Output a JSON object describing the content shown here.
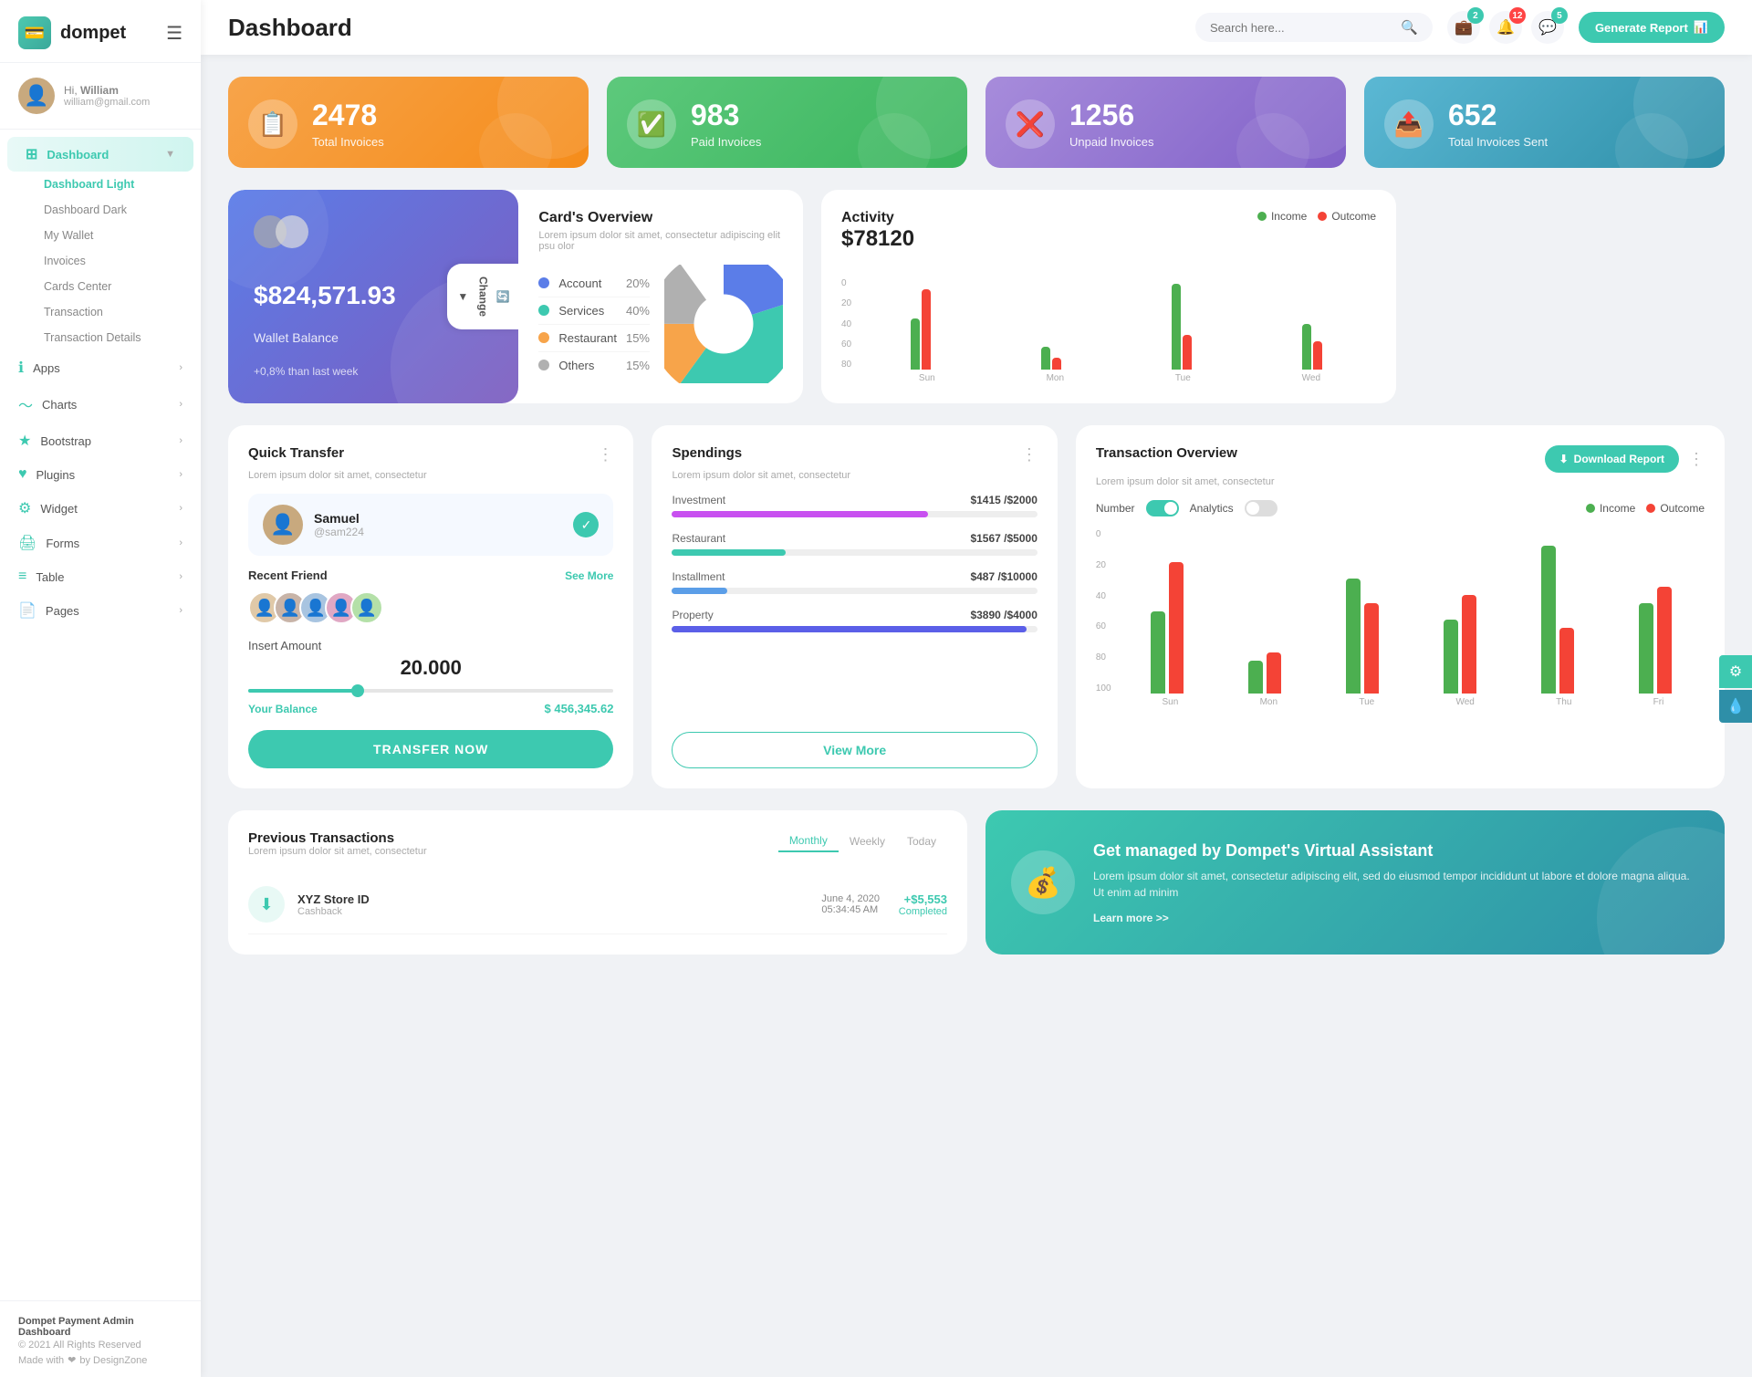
{
  "app": {
    "name": "dompet",
    "hamburger": "☰"
  },
  "user": {
    "hi": "Hi,",
    "name": "William",
    "email": "william@gmail.com",
    "avatar": "👤"
  },
  "header": {
    "title": "Dashboard",
    "search_placeholder": "Search here...",
    "generate_btn": "Generate Report",
    "badges": {
      "bell": "2",
      "notification": "12",
      "chat": "5"
    }
  },
  "stats": [
    {
      "number": "2478",
      "label": "Total Invoices",
      "icon": "📋",
      "color": "orange"
    },
    {
      "number": "983",
      "label": "Paid Invoices",
      "icon": "✅",
      "color": "green"
    },
    {
      "number": "1256",
      "label": "Unpaid Invoices",
      "icon": "❌",
      "color": "purple"
    },
    {
      "number": "652",
      "label": "Total Invoices Sent",
      "icon": "📤",
      "color": "teal"
    }
  ],
  "wallet": {
    "amount": "$824,571.93",
    "label": "Wallet Balance",
    "change": "+0,8% than last week",
    "change_btn": "Change"
  },
  "cards_overview": {
    "title": "Card's Overview",
    "sub": "Lorem ipsum dolor sit amet, consectetur adipiscing elit psu olor",
    "items": [
      {
        "label": "Account",
        "pct": "20%",
        "color": "blue"
      },
      {
        "label": "Services",
        "pct": "40%",
        "color": "teal"
      },
      {
        "label": "Restaurant",
        "pct": "15%",
        "color": "orange"
      },
      {
        "label": "Others",
        "pct": "15%",
        "color": "gray"
      }
    ]
  },
  "activity": {
    "title": "Activity",
    "amount": "$78120",
    "legend": {
      "income": "Income",
      "outcome": "Outcome"
    },
    "bars": [
      {
        "day": "Sun",
        "income": 45,
        "outcome": 70
      },
      {
        "day": "Mon",
        "income": 20,
        "outcome": 10
      },
      {
        "day": "Tue",
        "income": 75,
        "outcome": 30
      },
      {
        "day": "Wed",
        "income": 40,
        "outcome": 25
      }
    ],
    "y_labels": [
      "0",
      "20",
      "40",
      "60",
      "80"
    ]
  },
  "quick_transfer": {
    "title": "Quick Transfer",
    "sub": "Lorem ipsum dolor sit amet, consectetur",
    "friend": {
      "name": "Samuel",
      "id": "@sam224",
      "avatar": "👤"
    },
    "recent_friends_label": "Recent Friend",
    "see_all": "See More",
    "friends": [
      "👤",
      "👤",
      "👤",
      "👤",
      "👤"
    ],
    "amount_label": "Insert Amount",
    "amount": "20.000",
    "balance_label": "Your Balance",
    "balance_value": "$ 456,345.62",
    "transfer_btn": "TRANSFER NOW"
  },
  "spendings": {
    "title": "Spendings",
    "sub": "Lorem ipsum dolor sit amet, consectetur",
    "items": [
      {
        "label": "Investment",
        "value": "$1415",
        "max": "$2000",
        "pct": 70,
        "color": "#c850f0"
      },
      {
        "label": "Restaurant",
        "value": "$1567",
        "max": "$5000",
        "pct": 31,
        "color": "#3dc9b0"
      },
      {
        "label": "Installment",
        "value": "$487",
        "max": "$10000",
        "pct": 15,
        "color": "#5b9ee8"
      },
      {
        "label": "Property",
        "value": "$3890",
        "max": "$4000",
        "pct": 97,
        "color": "#5b5fe8"
      }
    ],
    "view_more_btn": "View More"
  },
  "tx_overview": {
    "title": "Transaction Overview",
    "sub": "Lorem ipsum dolor sit amet, consectetur",
    "download_btn": "Download Report",
    "toggle_number": "Number",
    "toggle_analytics": "Analytics",
    "legend": {
      "income": "Income",
      "outcome": "Outcome"
    },
    "y_labels": [
      "0",
      "20",
      "40",
      "60",
      "80",
      "100"
    ],
    "bars": [
      {
        "day": "Sun",
        "income": 50,
        "outcome": 80
      },
      {
        "day": "Mon",
        "income": 20,
        "outcome": 25
      },
      {
        "day": "Tue",
        "income": 70,
        "outcome": 55
      },
      {
        "day": "Wed",
        "income": 45,
        "outcome": 60
      },
      {
        "day": "Thu",
        "income": 90,
        "outcome": 40
      },
      {
        "day": "Fri",
        "income": 55,
        "outcome": 65
      }
    ]
  },
  "prev_tx": {
    "title": "Previous Transactions",
    "sub": "Lorem ipsum dolor sit amet, consectetur",
    "tabs": [
      "Monthly",
      "Weekly",
      "Today"
    ],
    "active_tab": "Monthly",
    "rows": [
      {
        "name": "XYZ Store ID",
        "type": "Cashback",
        "date": "June 4, 2020",
        "time": "05:34:45 AM",
        "amount": "+$5,553",
        "status": "Completed",
        "icon": "⬇"
      }
    ]
  },
  "virtual_assistant": {
    "title": "Get managed by Dompet's Virtual Assistant",
    "desc": "Lorem ipsum dolor sit amet, consectetur adipiscing elit, sed do eiusmod tempor incididunt ut labore et dolore magna aliqua. Ut enim ad minim",
    "learn_more": "Learn more >>",
    "icon": "💰"
  },
  "sidebar": {
    "main_items": [
      {
        "id": "dashboard",
        "label": "Dashboard",
        "icon": "⊞",
        "active": true,
        "has_sub": true
      },
      {
        "id": "apps",
        "label": "Apps",
        "icon": "ℹ",
        "active": false,
        "has_arrow": true
      },
      {
        "id": "charts",
        "label": "Charts",
        "icon": "〜",
        "active": false,
        "has_arrow": true
      },
      {
        "id": "bootstrap",
        "label": "Bootstrap",
        "icon": "★",
        "active": false,
        "has_arrow": true
      },
      {
        "id": "plugins",
        "label": "Plugins",
        "icon": "♥",
        "active": false,
        "has_arrow": true
      },
      {
        "id": "widget",
        "label": "Widget",
        "icon": "⚙",
        "active": false,
        "has_arrow": true
      },
      {
        "id": "forms",
        "label": "Forms",
        "icon": "🖨",
        "active": false,
        "has_arrow": true
      },
      {
        "id": "table",
        "label": "Table",
        "icon": "≡",
        "active": false,
        "has_arrow": true
      },
      {
        "id": "pages",
        "label": "Pages",
        "icon": "📋",
        "active": false,
        "has_arrow": true
      }
    ],
    "sub_items": [
      {
        "label": "Dashboard Light",
        "active": true
      },
      {
        "label": "Dashboard Dark",
        "active": false
      },
      {
        "label": "My Wallet",
        "active": false
      },
      {
        "label": "Invoices",
        "active": false
      },
      {
        "label": "Cards Center",
        "active": false
      },
      {
        "label": "Transaction",
        "active": false
      },
      {
        "label": "Transaction Details",
        "active": false
      }
    ],
    "footer": {
      "brand": "Dompet Payment Admin Dashboard",
      "year": "© 2021 All Rights Reserved",
      "made_with": "Made with",
      "heart": "❤",
      "by": "by DesignZone"
    }
  }
}
